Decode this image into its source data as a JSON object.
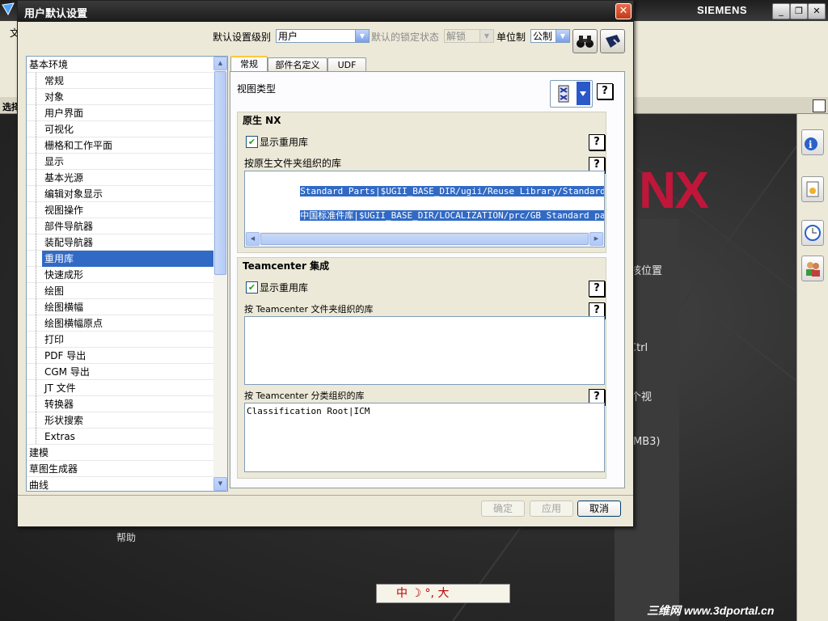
{
  "app": {
    "brand": "SIEMENS",
    "logo_text": "NX",
    "select_label": "选择",
    "menu_fragment": "文",
    "win_min": "_",
    "win_restore": "❐",
    "win_close": "✕",
    "right_panel_icons": [
      "info-icon",
      "document-icon",
      "clock-icon",
      "users-icon"
    ],
    "workspace_fragments": [
      "核位置",
      "Ctrl",
      "个视",
      "MB3)"
    ],
    "help_label": "帮助",
    "ime_bar_text": "中 ☽ °, 大",
    "watermark": "三维网 www.3dportal.cn"
  },
  "dialog": {
    "title": "用户默认设置",
    "close": "✕",
    "toolbar": {
      "level_label": "默认设置级别",
      "level_value": "用户",
      "lock_label": "默认的锁定状态",
      "lock_value": "解锁",
      "unit_label": "单位制",
      "unit_value": "公制",
      "find_icon": "binoculars-icon",
      "manage_icon": "manage-defaults-icon"
    },
    "tree": {
      "items": [
        {
          "label": "基本环境",
          "level": 0
        },
        {
          "label": "常规",
          "level": 1
        },
        {
          "label": "对象",
          "level": 1
        },
        {
          "label": "用户界面",
          "level": 1
        },
        {
          "label": "可视化",
          "level": 1
        },
        {
          "label": "栅格和工作平面",
          "level": 1
        },
        {
          "label": "显示",
          "level": 1
        },
        {
          "label": "基本光源",
          "level": 1
        },
        {
          "label": "编辑对象显示",
          "level": 1
        },
        {
          "label": "视图操作",
          "level": 1
        },
        {
          "label": "部件导航器",
          "level": 1
        },
        {
          "label": "装配导航器",
          "level": 1
        },
        {
          "label": "重用库",
          "level": 1,
          "selected": true
        },
        {
          "label": "快速成形",
          "level": 1
        },
        {
          "label": "绘图",
          "level": 1
        },
        {
          "label": "绘图横幅",
          "level": 1
        },
        {
          "label": "绘图横幅原点",
          "level": 1
        },
        {
          "label": "打印",
          "level": 1
        },
        {
          "label": "PDF 导出",
          "level": 1
        },
        {
          "label": "CGM 导出",
          "level": 1
        },
        {
          "label": "JT 文件",
          "level": 1
        },
        {
          "label": "转换器",
          "level": 1
        },
        {
          "label": "形状搜索",
          "level": 1
        },
        {
          "label": "Extras",
          "level": 1
        },
        {
          "label": "建模",
          "level": 0
        },
        {
          "label": "草图生成器",
          "level": 0
        },
        {
          "label": "曲线",
          "level": 0
        }
      ]
    },
    "tabs": [
      {
        "label": "常规",
        "active": true
      },
      {
        "label": "部件名定义",
        "active": false
      },
      {
        "label": "UDF",
        "active": false
      }
    ],
    "view_type_label": "视图类型",
    "native": {
      "header": "原生 NX",
      "show_reuse_label": "显示重用库",
      "show_reuse_checked": true,
      "folder_label": "按原生文件夹组织的库",
      "folder_entries": [
        "Standard Parts|$UGII_BASE_DIR/ugii/Reuse Library/Standard Parts",
        "中国标准件库|$UGII_BASE_DIR/LOCALIZATION/prc/GB Standard parts"
      ]
    },
    "teamcenter": {
      "header": "Teamcenter 集成",
      "show_reuse_label": "显示重用库",
      "show_reuse_checked": true,
      "folder_label": "按 Teamcenter 文件夹组织的库",
      "class_label": "按 Teamcenter 分类组织的库",
      "class_entries": [
        "Classification Root|ICM"
      ]
    },
    "help_glyph": "?",
    "buttons": {
      "ok": "确定",
      "apply": "应用",
      "cancel": "取消"
    }
  }
}
